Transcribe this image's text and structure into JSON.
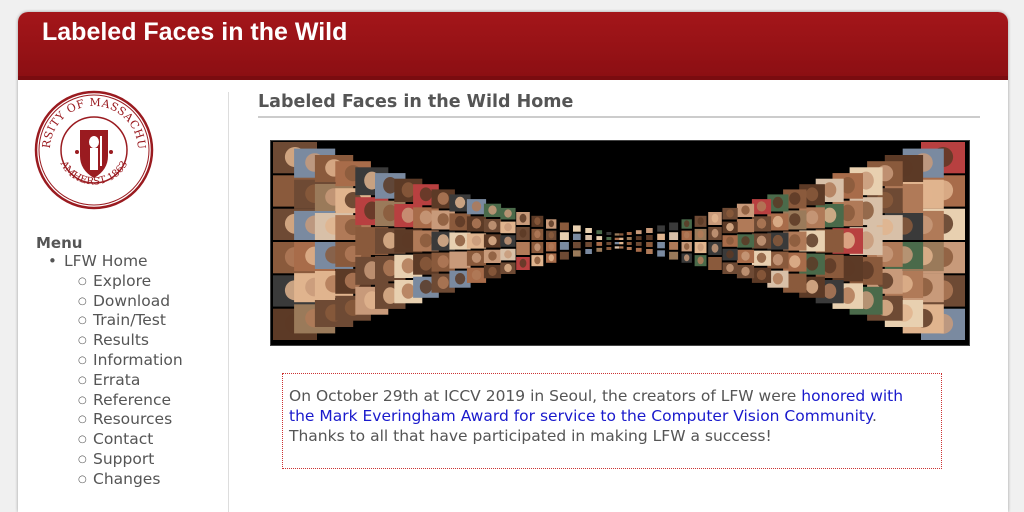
{
  "header": {
    "title": "Labeled Faces in the Wild"
  },
  "seal": {
    "ring_text": "UNIVERSITY OF MASSACHUSETTS",
    "bottom_text": "AMHERST 1863"
  },
  "menu": {
    "title": "Menu",
    "home": "LFW Home",
    "items": [
      "Explore",
      "Download",
      "Train/Test",
      "Results",
      "Information",
      "Errata",
      "Reference",
      "Resources",
      "Contact",
      "Support",
      "Changes"
    ]
  },
  "main": {
    "title": "Labeled Faces in the Wild Home",
    "notice": {
      "before": "On October 29th at ICCV 2019 in Seoul, the creators of LFW were ",
      "link": "honored with the Mark Everingham Award for service to the Computer Vision Community",
      "after": ". Thanks to all that have participated in making LFW a success!"
    }
  },
  "colors": {
    "header_red": "#a4161a",
    "seal_red": "#9a1b20",
    "link_blue": "#1a1acc",
    "text_gray": "#555555"
  }
}
